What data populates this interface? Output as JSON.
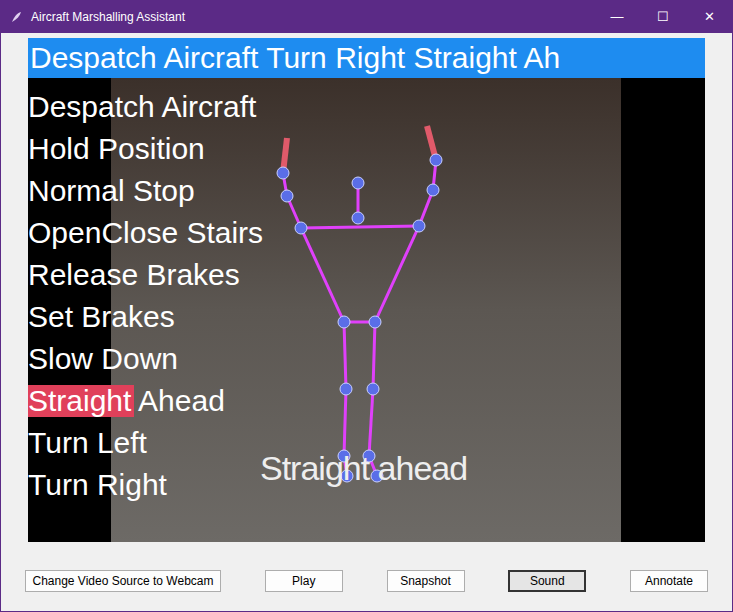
{
  "window": {
    "title": "Aircraft Marshalling Assistant",
    "controls": [
      "—",
      "☐",
      "✕"
    ]
  },
  "banner": {
    "text": "Despatch Aircraft Turn Right Straight Ah"
  },
  "gestures": [
    {
      "name": "Despatch Aircraft",
      "level": 0
    },
    {
      "name": "Hold Position",
      "level": 0
    },
    {
      "name": "Normal Stop",
      "level": 0
    },
    {
      "name": "OpenClose Stairs",
      "level": 0
    },
    {
      "name": "Release Brakes",
      "level": 0
    },
    {
      "name": "Set Brakes",
      "level": 0
    },
    {
      "name": "Slow Down",
      "level": 0
    },
    {
      "name": "Straight Ahead",
      "level": 0.45
    },
    {
      "name": "Turn Left",
      "level": 0
    },
    {
      "name": "Turn Right",
      "level": 0
    }
  ],
  "prediction": {
    "text": "Straight ahead"
  },
  "buttons": [
    {
      "label": "Change Video Source to Webcam",
      "selected": false
    },
    {
      "label": "Play",
      "selected": false
    },
    {
      "label": "Snapshot",
      "selected": false
    },
    {
      "label": "Sound",
      "selected": true
    },
    {
      "label": "Annotate",
      "selected": false
    }
  ]
}
